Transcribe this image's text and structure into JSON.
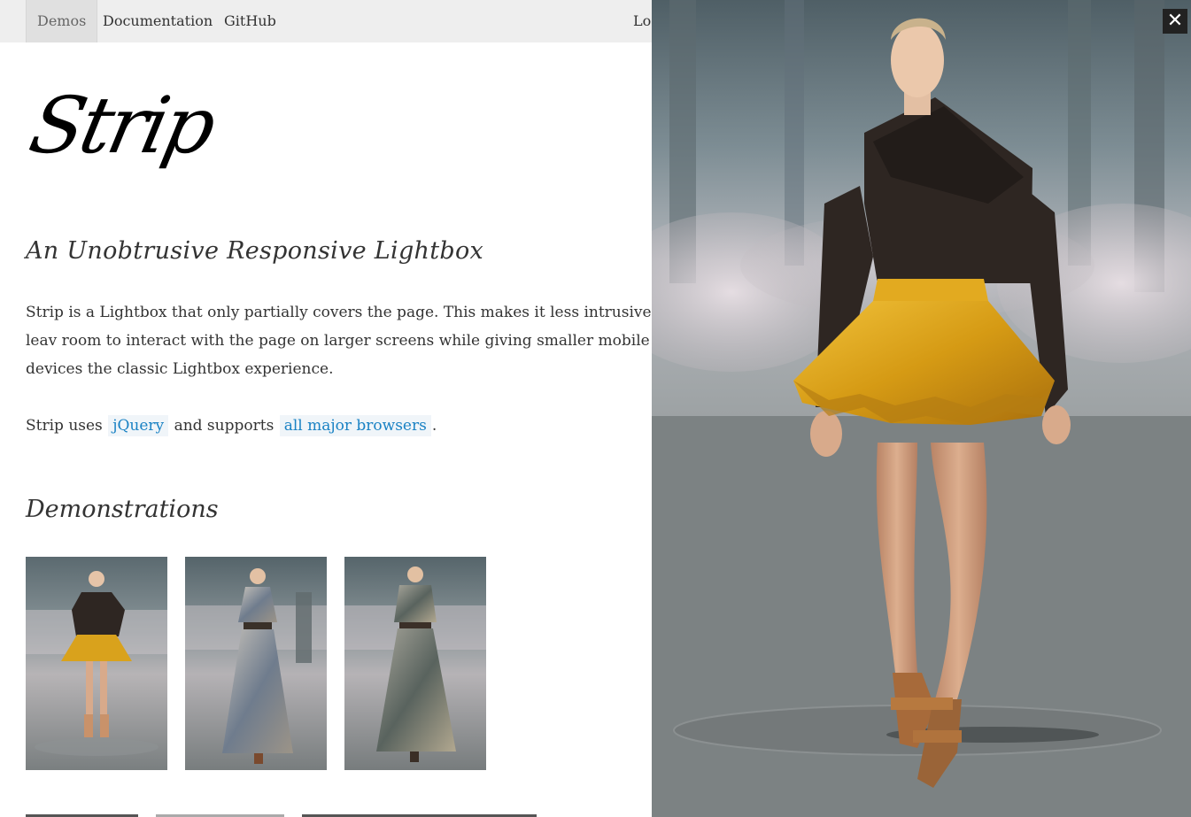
{
  "nav": {
    "items": [
      {
        "label": "Demos",
        "active": true
      },
      {
        "label": "Documentation",
        "active": false
      },
      {
        "label": "GitHub",
        "active": false
      }
    ],
    "right_label": "Log"
  },
  "logo": {
    "text": "Strip"
  },
  "subtitle": "An Unobtrusive Responsive Lightbox",
  "intro": "Strip is a Lightbox that only partially covers the page. This makes it less intrusive and leav room to interact with the page on larger screens while giving smaller mobile devices the classic Lightbox experience.",
  "uses": {
    "prefix": "Strip uses",
    "link1": "jQuery",
    "middle": "and supports",
    "link2": "all major browsers",
    "suffix": "."
  },
  "demonstrations": {
    "title": "Demonstrations",
    "thumbnails": [
      {
        "label": "runway-model-yellow-skirt"
      },
      {
        "label": "runway-model-printed-gown-belt"
      },
      {
        "label": "runway-model-printed-dress"
      }
    ]
  },
  "lightbox": {
    "image": "runway-model-yellow-skirt-large",
    "close_icon": "close-icon",
    "close_glyph": "✕"
  },
  "colors": {
    "link": "#1a82c4",
    "nav_bg": "#eeeeee",
    "skirt": "#d9a21c",
    "sweater": "#2e2622"
  }
}
